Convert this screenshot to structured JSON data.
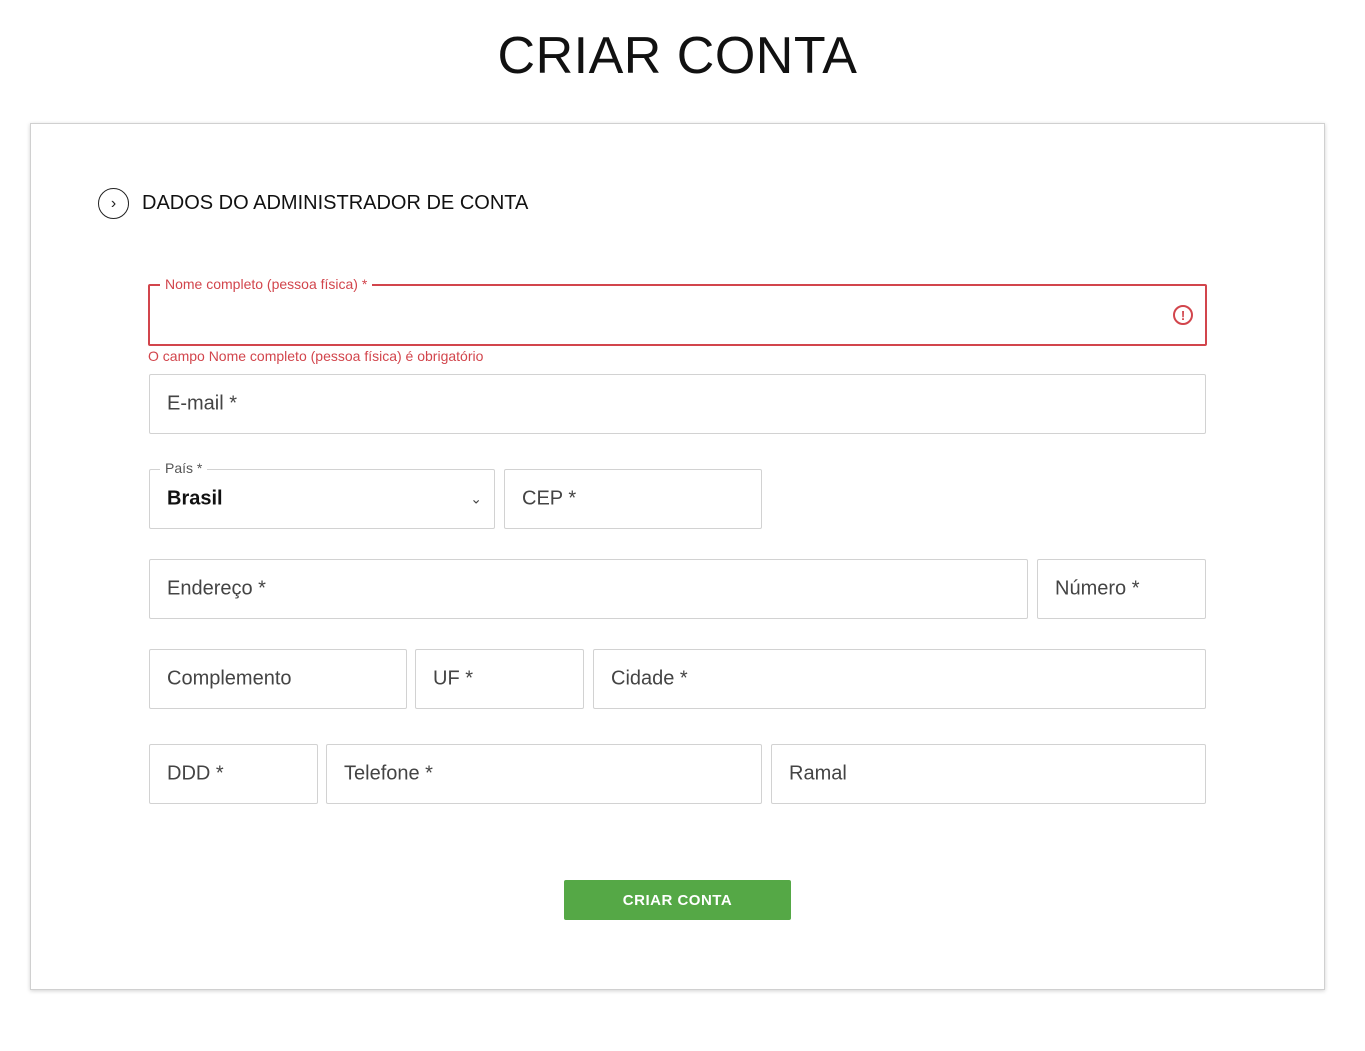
{
  "page": {
    "title": "CRIAR CONTA"
  },
  "section": {
    "title": "DADOS DO ADMINISTRADOR DE CONTA",
    "icon": "chevron-right-circle-icon"
  },
  "form": {
    "nome": {
      "label": "Nome completo (pessoa física) *",
      "value": "",
      "error": "O campo Nome completo (pessoa física) é obrigatório",
      "error_icon": "exclamation-circle-icon"
    },
    "email": {
      "placeholder": "E-mail *"
    },
    "pais": {
      "label": "País *",
      "value": "Brasil"
    },
    "cep": {
      "placeholder": "CEP *"
    },
    "endereco": {
      "placeholder": "Endereço *"
    },
    "numero": {
      "placeholder": "Número *"
    },
    "complemento": {
      "placeholder": "Complemento"
    },
    "uf": {
      "placeholder": "UF *"
    },
    "cidade": {
      "placeholder": "Cidade *"
    },
    "ddd": {
      "placeholder": "DDD *"
    },
    "telefone": {
      "placeholder": "Telefone *"
    },
    "ramal": {
      "placeholder": "Ramal"
    }
  },
  "actions": {
    "submit_label": "CRIAR CONTA"
  },
  "colors": {
    "error": "#d2454c",
    "button": "#55a846",
    "border": "#d2d2d2"
  }
}
